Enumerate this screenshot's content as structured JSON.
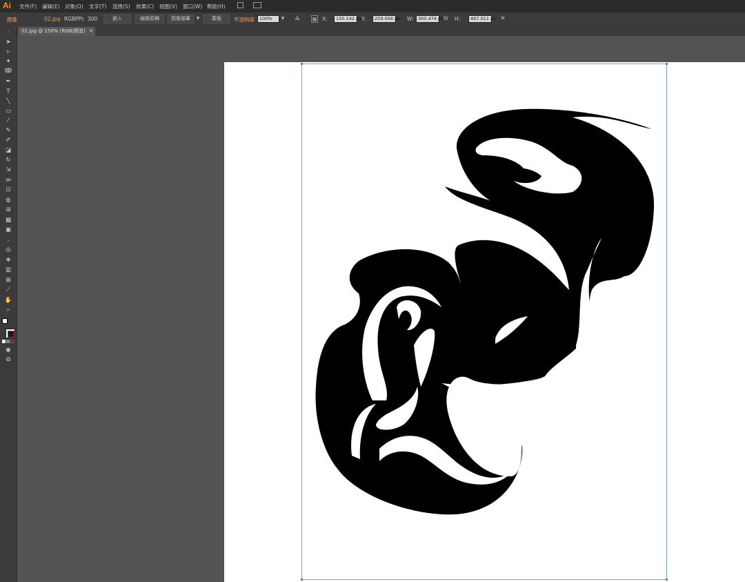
{
  "app": {
    "logo": "Ai"
  },
  "menu": [
    {
      "label": "文件(F)"
    },
    {
      "label": "编辑(E)"
    },
    {
      "label": "对象(O)"
    },
    {
      "label": "文字(T)"
    },
    {
      "label": "选择(S)"
    },
    {
      "label": "效果(C)"
    },
    {
      "label": "视图(V)"
    },
    {
      "label": "窗口(W)"
    },
    {
      "label": "帮助(H)"
    }
  ],
  "control": {
    "selection_type": "图像",
    "filename": "02.jpg",
    "color_mode": "RGB",
    "ppi_label": "PPI:",
    "ppi_value": "300",
    "embed_button": "嵌入",
    "edit_original_button": "编辑原稿",
    "image_trace_button": "图像描摹",
    "mask_button": "蒙版",
    "opacity_label": "不透明度",
    "opacity_value": "100%",
    "x_label": "X:",
    "x_value": "150.142 px",
    "y_label": "Y:",
    "y_value": "259.056 px",
    "w_label": "W:",
    "w_value": "300.474 px",
    "h_label": "H:",
    "h_value": "497.011 px"
  },
  "document": {
    "tab_title": "02.jpg @ 150% (RGB/预览)"
  },
  "toolbar": {
    "tools": [
      "selection-tool-icon",
      "direct-selection-tool-icon",
      "magic-wand-tool-icon",
      "lasso-tool-icon",
      "pen-tool-icon",
      "type-tool-icon",
      "line-tool-icon",
      "rectangle-tool-icon",
      "paintbrush-tool-icon",
      "pencil-tool-icon",
      "blob-brush-tool-icon",
      "eraser-tool-icon",
      "rotate-tool-icon",
      "scale-tool-icon",
      "width-tool-icon",
      "free-transform-tool-icon",
      "shape-builder-tool-icon",
      "perspective-grid-tool-icon",
      "mesh-tool-icon",
      "gradient-tool-icon",
      "eyedropper-tool-icon",
      "blend-tool-icon",
      "symbol-sprayer-tool-icon",
      "column-graph-tool-icon",
      "artboard-tool-icon",
      "slice-tool-icon",
      "hand-tool-icon",
      "zoom-tool-icon"
    ]
  },
  "colors": {
    "accent": "#ff8a1a",
    "panel": "#3b3b3b",
    "canvas": "#535353",
    "artboard": "#ffffff",
    "bounds": "#7ea0c8"
  }
}
